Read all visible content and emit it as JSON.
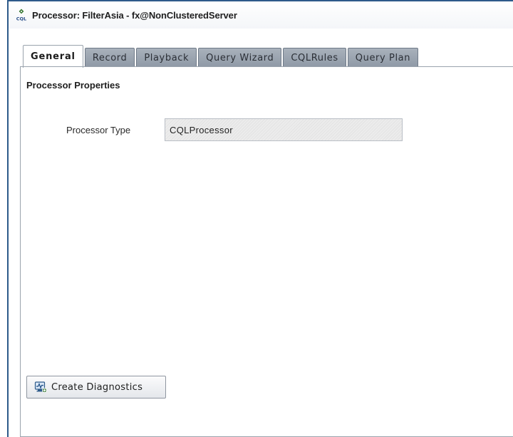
{
  "window": {
    "title": "Processor: FilterAsia - fx@NonClusteredServer",
    "icon": "cql-processor-icon"
  },
  "tabs": [
    {
      "label": "General",
      "active": true
    },
    {
      "label": "Record",
      "active": false
    },
    {
      "label": "Playback",
      "active": false
    },
    {
      "label": "Query Wizard",
      "active": false
    },
    {
      "label": "CQLRules",
      "active": false
    },
    {
      "label": "Query Plan",
      "active": false
    }
  ],
  "general": {
    "section_title": "Processor Properties",
    "processor_type_label": "Processor Type",
    "processor_type_value": "CQLProcessor",
    "create_diagnostics_label": "Create Diagnostics",
    "create_diagnostics_icon": "diagnostics-monitor-icon"
  },
  "colors": {
    "window_border": "#2d5a8a",
    "tab_inactive": "#9aa3ad",
    "tab_active": "#ffffff"
  }
}
